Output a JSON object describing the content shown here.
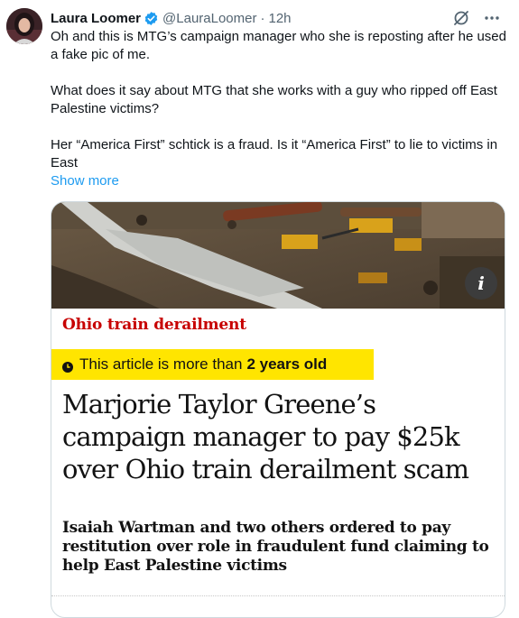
{
  "author": {
    "display_name": "Laura Loomer",
    "handle": "@LauraLoomer",
    "separator": "·",
    "time": "12h",
    "verified_icon": "verified-badge-icon"
  },
  "post": {
    "paragraphs": [
      "Oh and this is MTG’s campaign manager who she is reposting after he used a fake pic of me.",
      "What does it say about MTG that she works with a guy who ripped off East Palestine victims?",
      "Her “America First” schtick is a fraud. Is it “America First” to lie to victims in East"
    ],
    "show_more": "Show more"
  },
  "article_card": {
    "info_button": "i",
    "kicker": "Ohio train derailment",
    "age_notice_prefix": "This article is more than",
    "age_notice_bold": "2 years old",
    "headline": "Marjorie Taylor Greene’s campaign manager to pay $25k over Ohio train derailment scam",
    "standfirst": "Isaiah Wartman and two others ordered to pay restitution over role in fraudulent fund claiming to help East Palestine victims"
  },
  "colors": {
    "link": "#1d9bf0",
    "kicker": "#c70000",
    "age_badge": "#ffe500",
    "secondary_text": "#536471"
  }
}
